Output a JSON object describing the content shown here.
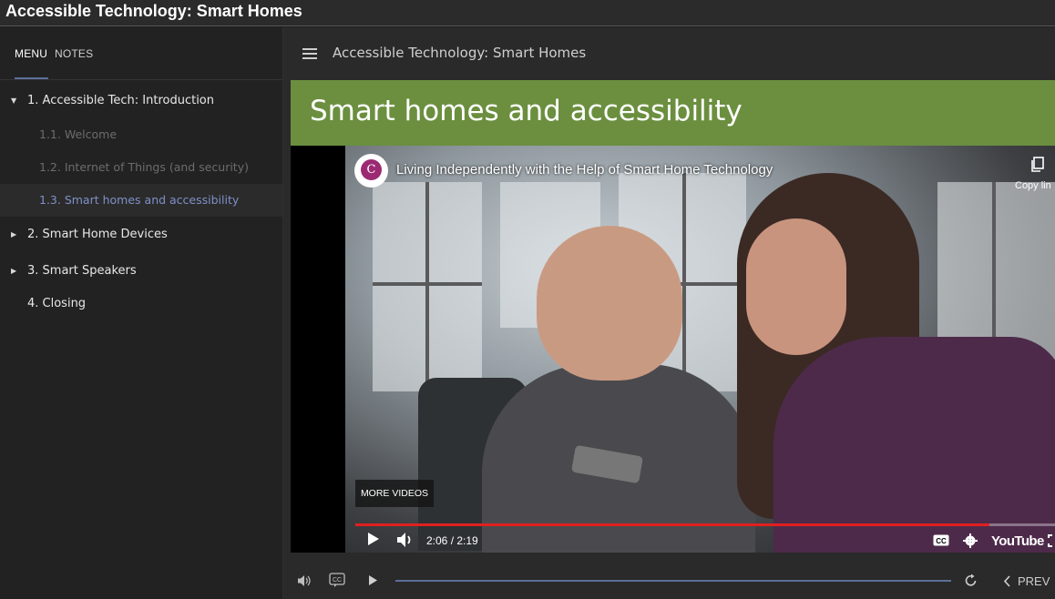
{
  "window": {
    "title": "Accessible Technology: Smart Homes"
  },
  "sidebar": {
    "tabs": [
      {
        "label": "MENU",
        "active": true
      },
      {
        "label": "NOTES",
        "active": false
      }
    ],
    "items": [
      {
        "label": "1. Accessible Tech: Introduction",
        "expanded": true
      },
      {
        "label": "1.1. Welcome"
      },
      {
        "label": "1.2. Internet of Things (and security)"
      },
      {
        "label": "1.3. Smart homes and accessibility",
        "active": true
      },
      {
        "label": "2. Smart Home Devices",
        "expanded": false
      },
      {
        "label": "3. Smart Speakers",
        "expanded": false
      },
      {
        "label": "4. Closing"
      }
    ]
  },
  "main": {
    "course_title": "Accessible Technology: Smart Homes",
    "slide_title": "Smart homes and accessibility",
    "banner_color": "#6b8f3f",
    "video": {
      "channel_logo_letter": "C",
      "title": "Living Independently with the Help of Smart Home Technology",
      "copy_link_label": "Copy lin",
      "more_videos_label": "MORE VIDEOS",
      "time": "2:06 / 2:19",
      "progress": 0.906,
      "brand": "YouTube",
      "progress_color": "#e02020"
    },
    "player": {
      "prev_label": "PREV",
      "progress": 1.0,
      "accent": "#5c6f9a"
    }
  }
}
